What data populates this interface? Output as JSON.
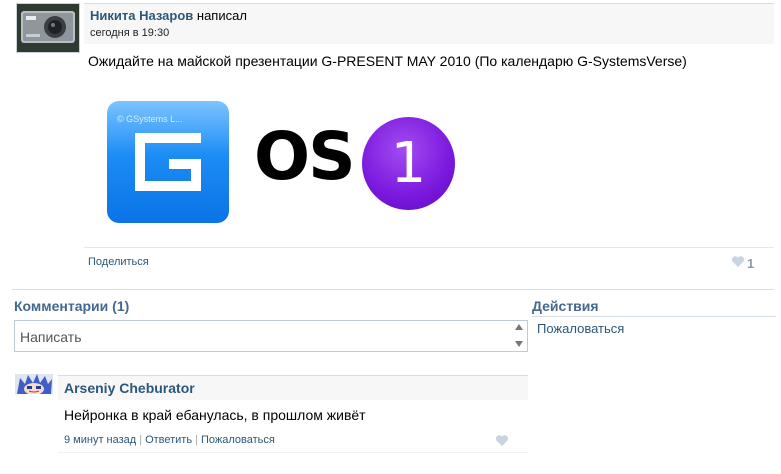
{
  "post": {
    "author": "Никита Назаров",
    "action": "написал",
    "timestamp": "сегодня в 19:30",
    "text": "Ожидайте на майской презентации G-PRESENT MAY 2010 (По календарю G-SystemsVerse)",
    "image": {
      "logo_caption": "© GSystems L...",
      "os_text": "OS",
      "number": "1"
    },
    "share_label": "Поделиться",
    "like_count": "1",
    "avatar_icon": "camera-icon"
  },
  "comments": {
    "header": "Комментарии (1)",
    "input_placeholder": "Написать",
    "items": [
      {
        "author": "Arseniy Cheburator",
        "text": "Нейронка в край ебанулась, в прошлом живёт",
        "time": "9 минут назад",
        "reply_label": "Ответить",
        "report_label": "Пожаловаться",
        "avatar_icon": "anime-avatar-icon"
      }
    ]
  },
  "actions": {
    "header": "Действия",
    "report_label": "Пожаловаться"
  },
  "colors": {
    "link": "#2b587a",
    "section_header": "#45688e",
    "logo_blue": "#1c8cf5",
    "circle_purple": "#7a18dd"
  }
}
